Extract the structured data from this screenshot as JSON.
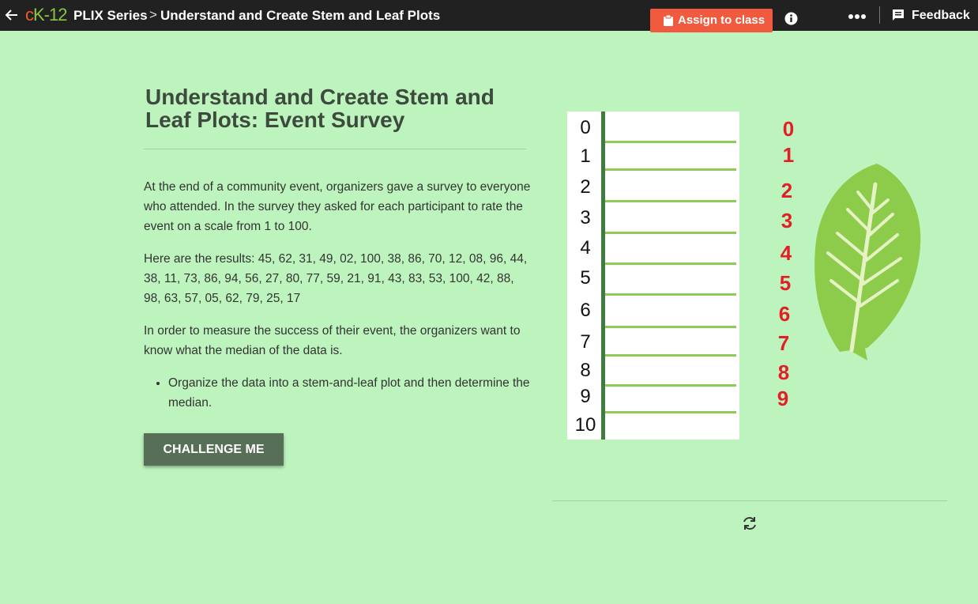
{
  "topbar": {
    "logo_c": "c",
    "logo_k": "K-12",
    "series": "PLIX Series",
    "separator": ">",
    "page_title": "Understand and Create Stem and Leaf Plots",
    "assign_label": "Assign to class",
    "feedback_label": "Feedback",
    "colors": {
      "background": "#212121",
      "assign": "#f05a3e",
      "logo_c": "#f05a28",
      "logo_k": "#8dc63f"
    }
  },
  "main": {
    "title": "Understand and Create Stem and Leaf Plots: Event Survey",
    "paragraphs": [
      "At the end of a community event, organizers gave a survey to everyone who attended. In the survey they asked for each participant to rate the event on a scale from 1 to 100.",
      "Here are the results: 45, 62, 31, 49, 02, 100, 38, 86, 70, 12, 08, 96, 44, 38, 11, 73, 86, 94, 56, 27, 80, 77, 59, 21, 91, 43, 83, 53, 100, 42, 88, 98, 63, 57, 05, 62, 79, 25, 17",
      "In order to measure the success of their event, the organizers want to know what the median of the data is."
    ],
    "bullets": [
      "Organize the data into a stem-and-leaf plot and then determine the median."
    ],
    "challenge_label": "CHALLENGE ME"
  },
  "plot": {
    "stems": [
      "0",
      "1",
      "2",
      "3",
      "4",
      "5",
      "6",
      "7",
      "8",
      "9",
      "10"
    ],
    "draggable_numbers": [
      "0",
      "1",
      "2",
      "3",
      "4",
      "5",
      "6",
      "7",
      "8",
      "9"
    ]
  },
  "icons": [
    "back-arrow-icon",
    "clipboard-icon",
    "info-icon",
    "more-icon",
    "feedback-icon",
    "leaf-icon",
    "refresh-icon"
  ],
  "colors": {
    "page_background": "#bdf4bd",
    "number_red": "#e41e26",
    "stem_green": "#3e7d3e",
    "leaf_line": "#8dcc57",
    "button": "#566f56"
  }
}
